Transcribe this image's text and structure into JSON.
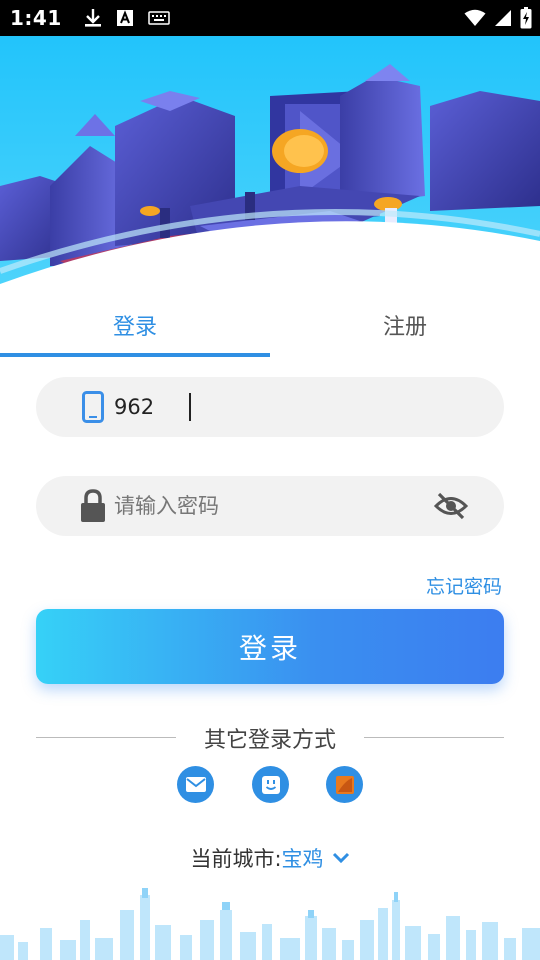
{
  "status_bar": {
    "time": "1:41",
    "icons_left": [
      "download-icon",
      "text-a-icon",
      "keyboard-icon"
    ],
    "icons_right": [
      "wifi-icon",
      "cellular-signal-icon",
      "battery-charging-icon"
    ]
  },
  "tabs": [
    {
      "label": "登录",
      "active": true
    },
    {
      "label": "注册",
      "active": false
    }
  ],
  "phone_field": {
    "value": "962",
    "icon": "phone-icon"
  },
  "password_field": {
    "placeholder": "请输入密码",
    "icon": "lock-icon",
    "toggle_icon": "eye-off-icon"
  },
  "forgot_password": "忘记密码",
  "login_button": "登录",
  "other_methods": {
    "title": "其它登录方式",
    "icons": [
      "mail-icon",
      "face-id-icon",
      "app-icon"
    ]
  },
  "city": {
    "label": "当前城市:",
    "value": "宝鸡",
    "icon": "chevron-down-icon"
  },
  "colors": {
    "accent": "#2f8fe3",
    "button_start": "#36d1f7",
    "button_end": "#3c7df0",
    "hero": "#29c6f8"
  }
}
